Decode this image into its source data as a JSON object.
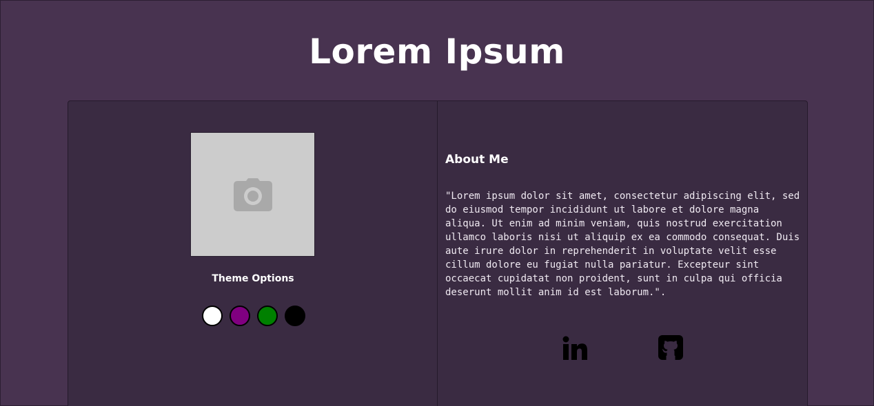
{
  "header": {
    "title": "Lorem Ipsum"
  },
  "profile": {
    "photo_icon": "camera-icon",
    "theme_label": "Theme Options",
    "themes": [
      {
        "name": "white",
        "color": "#ffffff"
      },
      {
        "name": "purple",
        "color": "#800080"
      },
      {
        "name": "green",
        "color": "#008000"
      },
      {
        "name": "black",
        "color": "#000000"
      }
    ]
  },
  "about": {
    "heading": "About Me",
    "text": "\"Lorem ipsum dolor sit amet, consectetur adipiscing elit, sed do eiusmod tempor incididunt ut labore et dolore magna aliqua. Ut enim ad minim veniam, quis nostrud exercitation ullamco laboris nisi ut aliquip ex ea commodo consequat. Duis aute irure dolor in reprehenderit in voluptate velit esse cillum dolore eu fugiat nulla pariatur. Excepteur sint occaecat cupidatat non proident, sunt in culpa qui officia deserunt mollit anim id est laborum.\"."
  },
  "social": {
    "links": [
      {
        "icon": "linkedin-icon"
      },
      {
        "icon": "github-icon"
      }
    ]
  },
  "colors": {
    "background": "#483350",
    "card": "#3a2b42",
    "photo_placeholder": "#cccccc",
    "camera": "#a9a9a9"
  }
}
